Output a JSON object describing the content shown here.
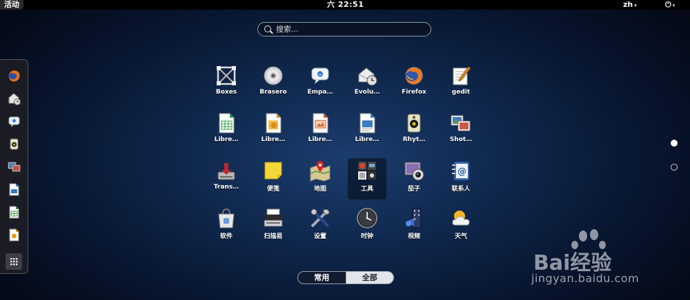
{
  "topbar": {
    "activities": "活动",
    "clock": "六 22:51",
    "language": "zh",
    "language_caret": "▾",
    "power_caret": "▾"
  },
  "search": {
    "placeholder": "搜索..."
  },
  "apps": [
    {
      "label": "Boxes",
      "icon": "boxes-icon"
    },
    {
      "label": "Brasero",
      "icon": "disc-icon"
    },
    {
      "label": "Empa…",
      "icon": "chat-bubble-icon"
    },
    {
      "label": "Evolu…",
      "icon": "mail-clock-icon"
    },
    {
      "label": "Firefox",
      "icon": "firefox-icon"
    },
    {
      "label": "gedit",
      "icon": "text-editor-icon"
    },
    {
      "label": "Libre…",
      "icon": "spreadsheet-icon"
    },
    {
      "label": "Libre…",
      "icon": "draw-icon"
    },
    {
      "label": "Libre…",
      "icon": "presentation-icon"
    },
    {
      "label": "Libre…",
      "icon": "writer-icon"
    },
    {
      "label": "Rhyt…",
      "icon": "speaker-icon"
    },
    {
      "label": "Shot…",
      "icon": "photos-icon"
    },
    {
      "label": "Trans…",
      "icon": "transmission-icon"
    },
    {
      "label": "便笺",
      "icon": "sticky-note-icon"
    },
    {
      "label": "地图",
      "icon": "map-icon"
    },
    {
      "label": "工具",
      "icon": "tools-icon"
    },
    {
      "label": "茄子",
      "icon": "webcam-icon"
    },
    {
      "label": "联系人",
      "icon": "contacts-icon"
    },
    {
      "label": "软件",
      "icon": "software-bag-icon"
    },
    {
      "label": "扫描易",
      "icon": "scanner-icon"
    },
    {
      "label": "设置",
      "icon": "settings-tools-icon"
    },
    {
      "label": "时钟",
      "icon": "clock-icon"
    },
    {
      "label": "视频",
      "icon": "video-icon"
    },
    {
      "label": "天气",
      "icon": "weather-icon"
    }
  ],
  "dash": [
    "firefox-icon",
    "mail-clock-icon",
    "chat-bubble-icon",
    "speaker-icon",
    "photos-icon",
    "writer-icon",
    "spreadsheet-icon",
    "draw-icon",
    "show-apps-icon"
  ],
  "tabs": {
    "frequent": "常用",
    "all": "全部"
  },
  "watermark": {
    "text": "Bai经验",
    "url": "jingyan.baidu.com"
  },
  "colors": {
    "background": "#0b1c3a",
    "topbar": "#000000",
    "selected_tab": "#e3e5ea"
  }
}
